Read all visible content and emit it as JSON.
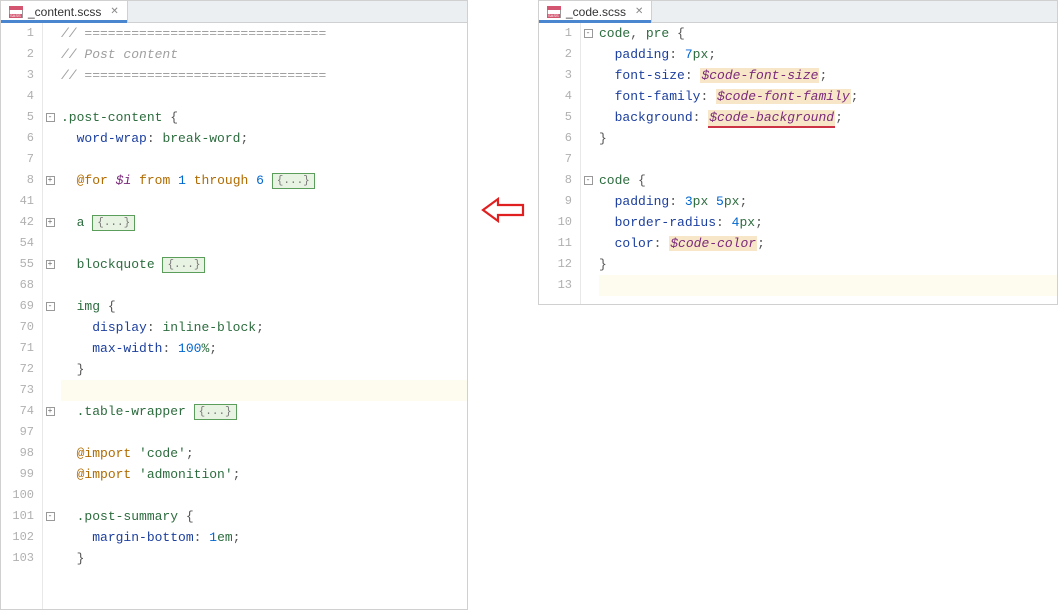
{
  "left": {
    "tab": {
      "filename": "_content.scss",
      "iconText": "SASS"
    },
    "lines": [
      {
        "n": "1",
        "fold": "",
        "hl": false,
        "tokens": [
          [
            "c-comment",
            "// ==============================="
          ]
        ]
      },
      {
        "n": "2",
        "fold": "",
        "hl": false,
        "tokens": [
          [
            "c-comment",
            "// Post content"
          ]
        ]
      },
      {
        "n": "3",
        "fold": "",
        "hl": false,
        "tokens": [
          [
            "c-comment",
            "// ==============================="
          ]
        ]
      },
      {
        "n": "4",
        "fold": "",
        "hl": false,
        "tokens": []
      },
      {
        "n": "5",
        "fold": "-",
        "hl": false,
        "tokens": [
          [
            "c-sel",
            ".post-content "
          ],
          [
            "c-punc",
            "{"
          ]
        ]
      },
      {
        "n": "6",
        "fold": "",
        "hl": false,
        "tokens": [
          [
            "",
            "  "
          ],
          [
            "c-prop",
            "word-wrap"
          ],
          [
            "c-punc",
            ": "
          ],
          [
            "c-val",
            "break-word"
          ],
          [
            "c-punc",
            ";"
          ]
        ]
      },
      {
        "n": "7",
        "fold": "",
        "hl": false,
        "tokens": []
      },
      {
        "n": "8",
        "fold": "+",
        "hl": false,
        "tokens": [
          [
            "",
            "  "
          ],
          [
            "c-kw",
            "@for"
          ],
          [
            "",
            " "
          ],
          [
            "c-var",
            "$i"
          ],
          [
            "",
            " "
          ],
          [
            "c-kw",
            "from"
          ],
          [
            "",
            " "
          ],
          [
            "c-num",
            "1"
          ],
          [
            "",
            " "
          ],
          [
            "c-kw",
            "through"
          ],
          [
            "",
            " "
          ],
          [
            "c-num",
            "6"
          ],
          [
            "",
            " "
          ],
          [
            "fold-box",
            "{...}"
          ]
        ]
      },
      {
        "n": "41",
        "fold": "",
        "hl": false,
        "tokens": []
      },
      {
        "n": "42",
        "fold": "+",
        "hl": false,
        "tokens": [
          [
            "",
            "  "
          ],
          [
            "c-sel",
            "a "
          ],
          [
            "fold-box",
            "{...}"
          ]
        ]
      },
      {
        "n": "54",
        "fold": "",
        "hl": false,
        "tokens": []
      },
      {
        "n": "55",
        "fold": "+",
        "hl": false,
        "tokens": [
          [
            "",
            "  "
          ],
          [
            "c-sel",
            "blockquote "
          ],
          [
            "fold-box",
            "{...}"
          ]
        ]
      },
      {
        "n": "68",
        "fold": "",
        "hl": false,
        "tokens": []
      },
      {
        "n": "69",
        "fold": "-",
        "hl": false,
        "tokens": [
          [
            "",
            "  "
          ],
          [
            "c-sel",
            "img "
          ],
          [
            "c-punc",
            "{"
          ]
        ]
      },
      {
        "n": "70",
        "fold": "",
        "hl": false,
        "tokens": [
          [
            "",
            "    "
          ],
          [
            "c-prop",
            "display"
          ],
          [
            "c-punc",
            ": "
          ],
          [
            "c-val",
            "inline-block"
          ],
          [
            "c-punc",
            ";"
          ]
        ]
      },
      {
        "n": "71",
        "fold": "",
        "hl": false,
        "tokens": [
          [
            "",
            "    "
          ],
          [
            "c-prop",
            "max-width"
          ],
          [
            "c-punc",
            ": "
          ],
          [
            "c-num",
            "100"
          ],
          [
            "c-val",
            "%"
          ],
          [
            "c-punc",
            ";"
          ]
        ]
      },
      {
        "n": "72",
        "fold": "",
        "hl": false,
        "tokens": [
          [
            "",
            "  "
          ],
          [
            "c-punc",
            "}"
          ]
        ]
      },
      {
        "n": "73",
        "fold": "",
        "hl": true,
        "tokens": []
      },
      {
        "n": "74",
        "fold": "+",
        "hl": false,
        "tokens": [
          [
            "",
            "  "
          ],
          [
            "c-sel",
            ".table-wrapper "
          ],
          [
            "fold-box",
            "{...}"
          ]
        ]
      },
      {
        "n": "97",
        "fold": "",
        "hl": false,
        "tokens": []
      },
      {
        "n": "98",
        "fold": "",
        "hl": false,
        "tokens": [
          [
            "",
            "  "
          ],
          [
            "c-kw",
            "@import"
          ],
          [
            "",
            " "
          ],
          [
            "c-str",
            "'code'"
          ],
          [
            "c-punc",
            ";"
          ]
        ]
      },
      {
        "n": "99",
        "fold": "",
        "hl": false,
        "tokens": [
          [
            "",
            "  "
          ],
          [
            "c-kw",
            "@import"
          ],
          [
            "",
            " "
          ],
          [
            "c-str",
            "'admonition'"
          ],
          [
            "c-punc",
            ";"
          ]
        ]
      },
      {
        "n": "100",
        "fold": "",
        "hl": false,
        "tokens": []
      },
      {
        "n": "101",
        "fold": "-",
        "hl": false,
        "tokens": [
          [
            "",
            "  "
          ],
          [
            "c-sel",
            ".post-summary "
          ],
          [
            "c-punc",
            "{"
          ]
        ]
      },
      {
        "n": "102",
        "fold": "",
        "hl": false,
        "tokens": [
          [
            "",
            "    "
          ],
          [
            "c-prop",
            "margin-bottom"
          ],
          [
            "c-punc",
            ": "
          ],
          [
            "c-num",
            "1"
          ],
          [
            "c-val",
            "em"
          ],
          [
            "c-punc",
            ";"
          ]
        ]
      },
      {
        "n": "103",
        "fold": "",
        "hl": false,
        "tokens": [
          [
            "",
            "  "
          ],
          [
            "c-punc",
            "}"
          ]
        ]
      }
    ]
  },
  "right": {
    "tab": {
      "filename": "_code.scss",
      "iconText": "SASS"
    },
    "lines": [
      {
        "n": "1",
        "fold": "-",
        "hl": false,
        "tokens": [
          [
            "c-sel",
            "code"
          ],
          [
            "c-punc",
            ", "
          ],
          [
            "c-sel",
            "pre "
          ],
          [
            "c-punc",
            "{"
          ]
        ]
      },
      {
        "n": "2",
        "fold": "",
        "hl": false,
        "tokens": [
          [
            "",
            "  "
          ],
          [
            "c-prop",
            "padding"
          ],
          [
            "c-punc",
            ": "
          ],
          [
            "c-num",
            "7"
          ],
          [
            "c-val",
            "px"
          ],
          [
            "c-punc",
            ";"
          ]
        ]
      },
      {
        "n": "3",
        "fold": "",
        "hl": false,
        "tokens": [
          [
            "",
            "  "
          ],
          [
            "c-prop",
            "font-size"
          ],
          [
            "c-punc",
            ": "
          ],
          [
            "c-var hl-var",
            "$code-font-size"
          ],
          [
            "c-punc",
            ";"
          ]
        ]
      },
      {
        "n": "4",
        "fold": "",
        "hl": false,
        "tokens": [
          [
            "",
            "  "
          ],
          [
            "c-prop",
            "font-family"
          ],
          [
            "c-punc",
            ": "
          ],
          [
            "c-var hl-var",
            "$code-font-family"
          ],
          [
            "c-punc",
            ";"
          ]
        ]
      },
      {
        "n": "5",
        "fold": "",
        "hl": false,
        "tokens": [
          [
            "",
            "  "
          ],
          [
            "c-prop",
            "background"
          ],
          [
            "c-punc",
            ": "
          ],
          [
            "c-var hl-var underline-red",
            "$code-background"
          ],
          [
            "c-punc",
            ";"
          ]
        ]
      },
      {
        "n": "6",
        "fold": "",
        "hl": false,
        "tokens": [
          [
            "c-punc",
            "}"
          ]
        ]
      },
      {
        "n": "7",
        "fold": "",
        "hl": false,
        "tokens": []
      },
      {
        "n": "8",
        "fold": "-",
        "hl": false,
        "tokens": [
          [
            "c-sel",
            "code "
          ],
          [
            "c-punc",
            "{"
          ]
        ]
      },
      {
        "n": "9",
        "fold": "",
        "hl": false,
        "tokens": [
          [
            "",
            "  "
          ],
          [
            "c-prop",
            "padding"
          ],
          [
            "c-punc",
            ": "
          ],
          [
            "c-num",
            "3"
          ],
          [
            "c-val",
            "px "
          ],
          [
            "c-num",
            "5"
          ],
          [
            "c-val",
            "px"
          ],
          [
            "c-punc",
            ";"
          ]
        ]
      },
      {
        "n": "10",
        "fold": "",
        "hl": false,
        "tokens": [
          [
            "",
            "  "
          ],
          [
            "c-prop",
            "border-radius"
          ],
          [
            "c-punc",
            ": "
          ],
          [
            "c-num",
            "4"
          ],
          [
            "c-val",
            "px"
          ],
          [
            "c-punc",
            ";"
          ]
        ]
      },
      {
        "n": "11",
        "fold": "",
        "hl": false,
        "tokens": [
          [
            "",
            "  "
          ],
          [
            "c-prop",
            "color"
          ],
          [
            "c-punc",
            ": "
          ],
          [
            "c-var hl-var",
            "$code-color"
          ],
          [
            "c-punc",
            ";"
          ]
        ]
      },
      {
        "n": "12",
        "fold": "",
        "hl": false,
        "tokens": [
          [
            "c-punc",
            "}"
          ]
        ]
      },
      {
        "n": "13",
        "fold": "",
        "hl": true,
        "tokens": []
      }
    ]
  },
  "arrow": {
    "color": "#e02020"
  }
}
